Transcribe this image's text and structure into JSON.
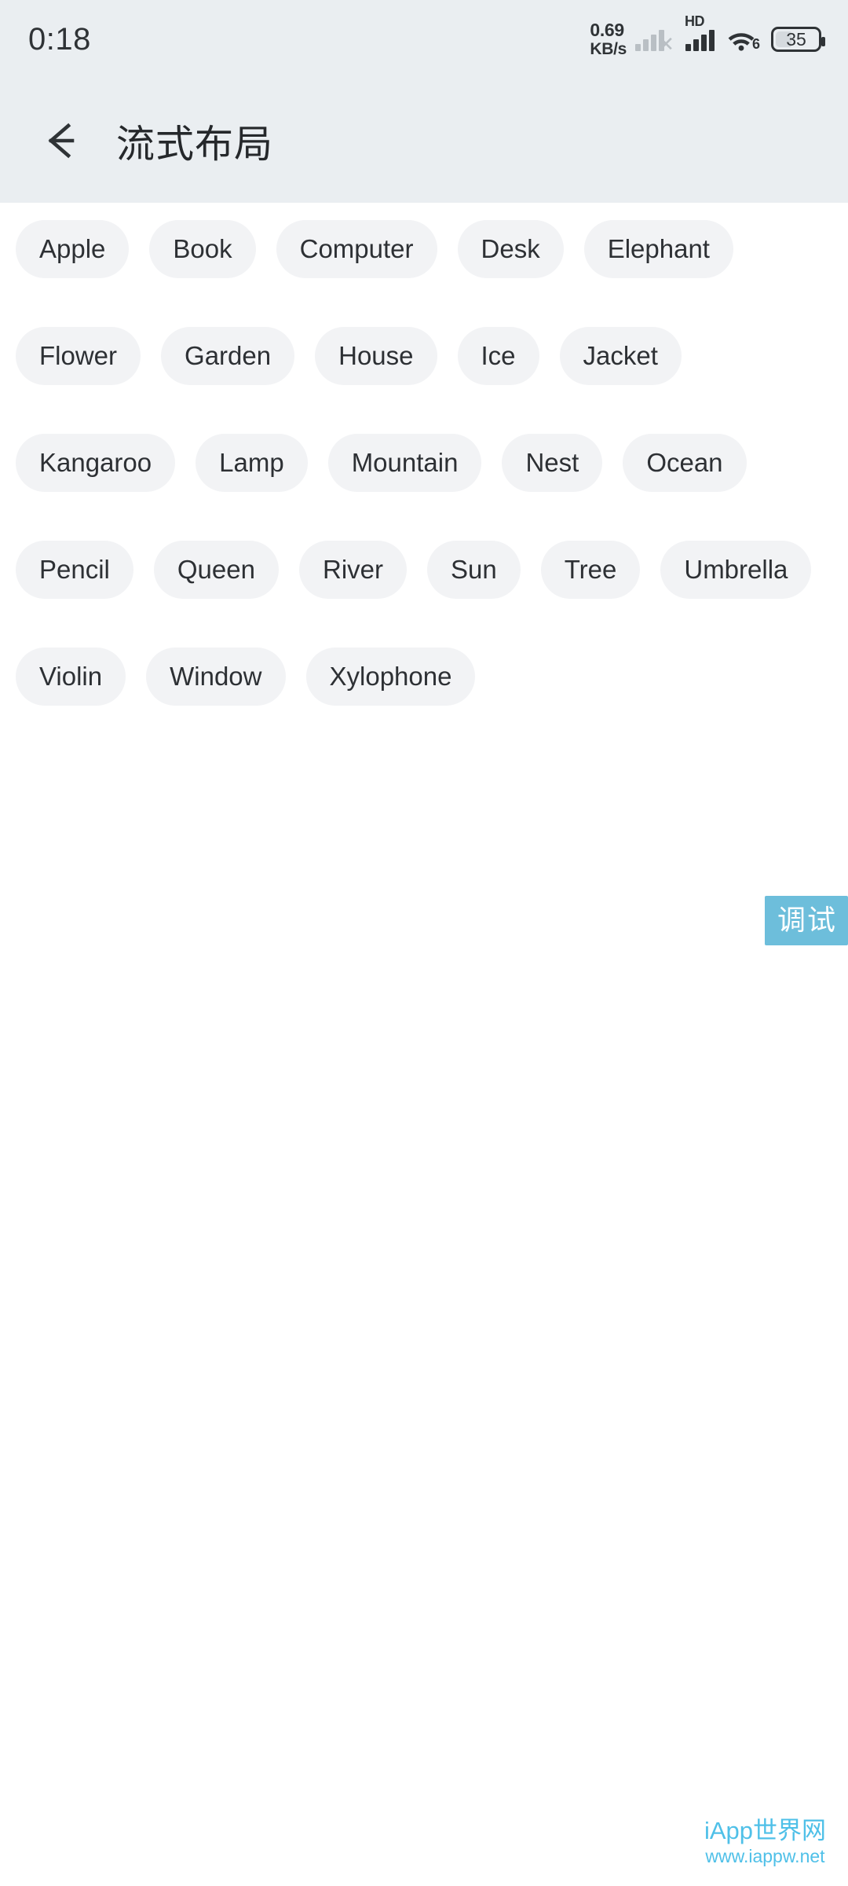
{
  "statusbar": {
    "time": "0:18",
    "network_speed_value": "0.69",
    "network_speed_unit": "KB/s",
    "hd_label": "HD",
    "wifi_generation": "6",
    "battery_level": "35",
    "no_sim_mark": "✕"
  },
  "appbar": {
    "back_label": "←",
    "title": "流式布局",
    "background": "#eaeef1"
  },
  "content": {
    "chip_background": "#f2f3f5",
    "chip_text_color": "#2d3034",
    "chips": [
      "Apple",
      "Book",
      "Computer",
      "Desk",
      "Elephant",
      "Flower",
      "Garden",
      "House",
      "Ice",
      "Jacket",
      "Kangaroo",
      "Lamp",
      "Mountain",
      "Nest",
      "Ocean",
      "Pencil",
      "Queen",
      "River",
      "Sun",
      "Tree",
      "Umbrella",
      "Violin",
      "Window",
      "Xylophone"
    ]
  },
  "debug_badge": {
    "label": "调试",
    "color": "#6dbedb"
  },
  "watermark": {
    "line1": "iApp世界网",
    "line2": "www.iappw.net",
    "color": "#4fc0e8"
  }
}
